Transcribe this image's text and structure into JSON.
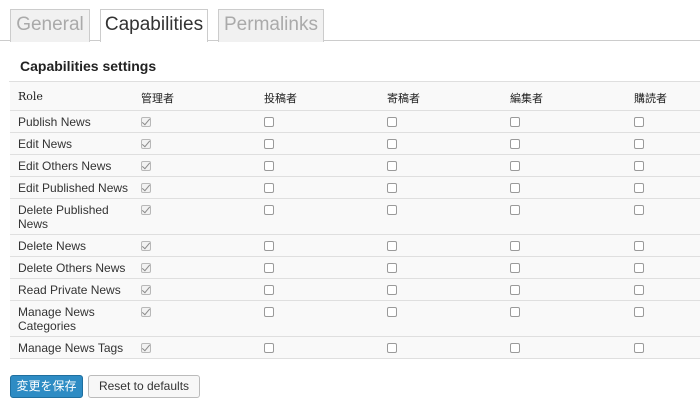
{
  "tabs": [
    {
      "label": "General",
      "active": false
    },
    {
      "label": "Capabilities",
      "active": true
    },
    {
      "label": "Permalinks",
      "active": false
    }
  ],
  "section_title": "Capabilities settings",
  "table": {
    "columns": [
      "Role",
      "管理者",
      "投稿者",
      "寄稿者",
      "編集者",
      "購読者"
    ],
    "rows": [
      {
        "label": "Publish News",
        "checked": [
          true,
          false,
          false,
          false,
          false
        ]
      },
      {
        "label": "Edit News",
        "checked": [
          true,
          false,
          false,
          false,
          false
        ]
      },
      {
        "label": "Edit Others News",
        "checked": [
          true,
          false,
          false,
          false,
          false
        ]
      },
      {
        "label": "Edit Published News",
        "checked": [
          true,
          false,
          false,
          false,
          false
        ]
      },
      {
        "label": "Delete Published News",
        "checked": [
          true,
          false,
          false,
          false,
          false
        ]
      },
      {
        "label": "Delete News",
        "checked": [
          true,
          false,
          false,
          false,
          false
        ]
      },
      {
        "label": "Delete Others News",
        "checked": [
          true,
          false,
          false,
          false,
          false
        ]
      },
      {
        "label": "Read Private News",
        "checked": [
          true,
          false,
          false,
          false,
          false
        ]
      },
      {
        "label": "Manage News Categories",
        "checked": [
          true,
          false,
          false,
          false,
          false
        ]
      },
      {
        "label": "Manage News Tags",
        "checked": [
          true,
          false,
          false,
          false,
          false
        ]
      }
    ]
  },
  "buttons": {
    "save_label": "変更を保存",
    "reset_label": "Reset to defaults"
  },
  "colors": {
    "primary_button": "#2e8cc4",
    "border": "#cccccc",
    "row_background": "#f9f9f9"
  }
}
